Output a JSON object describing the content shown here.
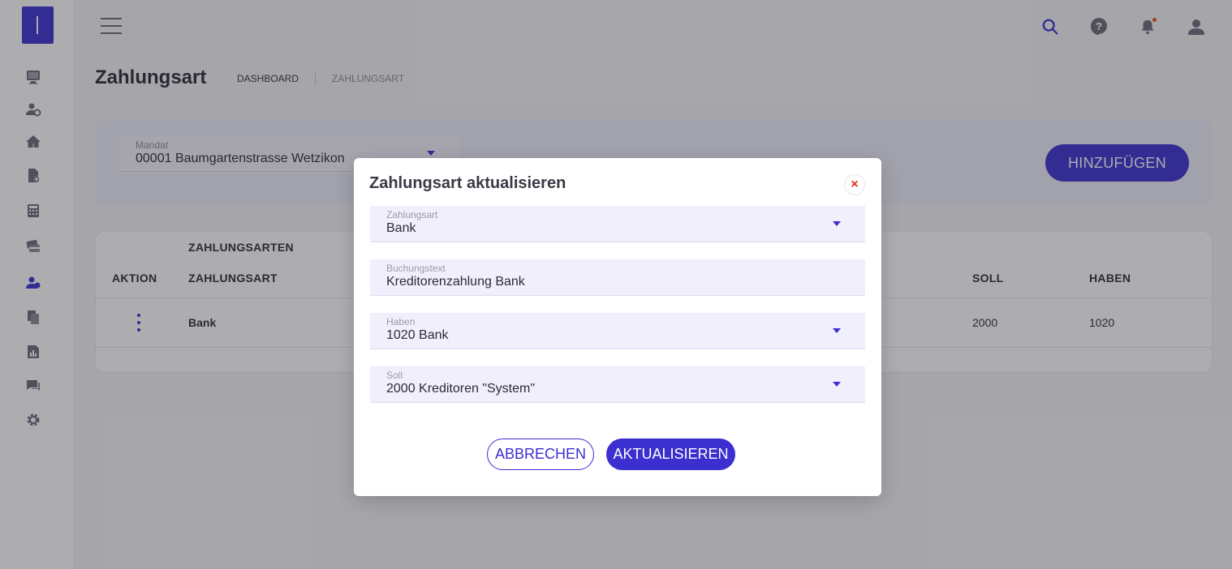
{
  "page": {
    "title": "Zahlungsart",
    "breadcrumb": [
      "DASHBOARD",
      "ZAHLUNGSART"
    ]
  },
  "sidebar": {
    "icons": [
      "monitor-icon",
      "user-settings-icon",
      "home-settings-icon",
      "document-settings-icon",
      "calculator-icon",
      "cards-icon",
      "users-icon",
      "files-icon",
      "report-icon",
      "chat-icon",
      "gear-icon"
    ]
  },
  "topbar": {
    "icons": [
      "menu-icon",
      "search-icon",
      "help-icon",
      "bell-icon",
      "user-icon"
    ]
  },
  "mandat": {
    "label": "Mandat",
    "value": "00001 Baumgartenstrasse Wetzikon"
  },
  "actions": {
    "add_label": "HINZUFÜGEN"
  },
  "table": {
    "group_header": "ZAHLUNGSARTEN",
    "columns": [
      "AKTION",
      "ZAHLUNGSART",
      "SOLL",
      "HABEN"
    ],
    "rows": [
      {
        "zahlungsart": "Bank",
        "soll": "2000",
        "haben": "1020"
      }
    ]
  },
  "modal": {
    "title": "Zahlungsart aktualisieren",
    "close_symbol": "×",
    "fields": [
      {
        "label": "Zahlungsart",
        "value": "Bank"
      },
      {
        "label": "Buchungstext",
        "value": "Kreditorenzahlung Bank"
      },
      {
        "label": "Haben",
        "value": "1020 Bank"
      },
      {
        "label": "Soll",
        "value": "2000 Kreditoren \"System\""
      }
    ],
    "cancel_label": "ABBRECHEN",
    "update_label": "AKTUALISIEREN"
  },
  "colors": {
    "primary": "#3b2fd0",
    "close": "#e0301a",
    "notification": "#e0501a"
  }
}
